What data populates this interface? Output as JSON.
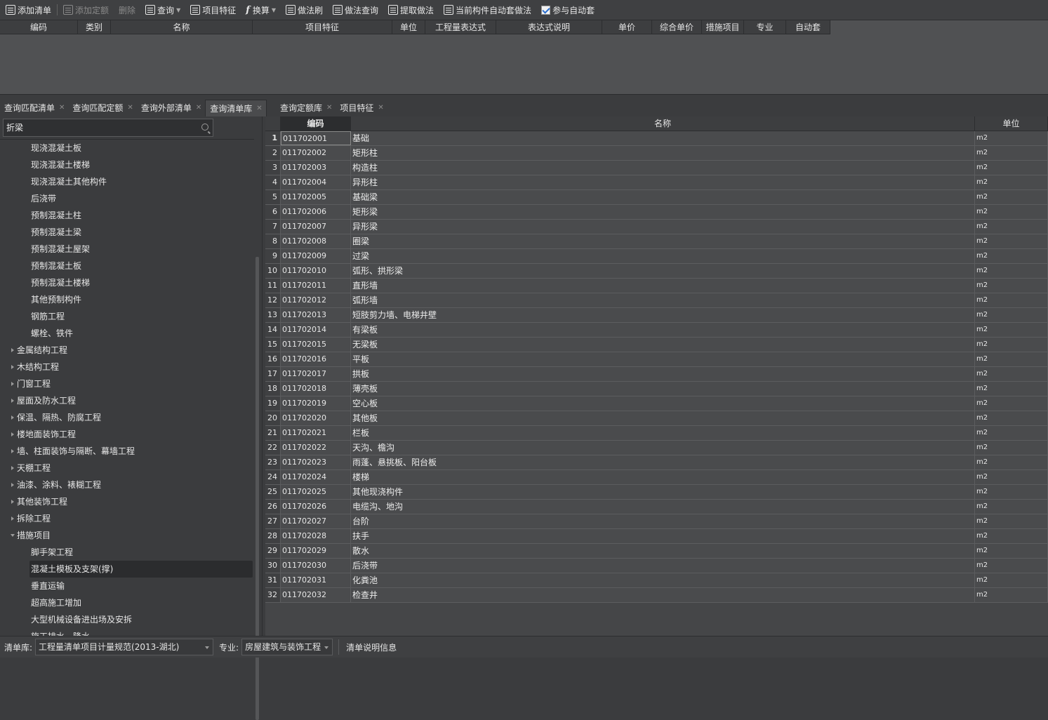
{
  "toolbar": {
    "add_list": "添加清单",
    "add_quota": "添加定额",
    "delete": "删除",
    "query": "查询",
    "item_feature": "项目特征",
    "convert": "换算",
    "method_brush": "做法刷",
    "method_query": "做法查询",
    "extract_method": "提取做法",
    "auto_apply_current": "当前构件自动套做法",
    "join_auto": "参与自动套"
  },
  "top_grid": {
    "columns": [
      "编码",
      "类别",
      "名称",
      "项目特征",
      "单位",
      "工程量表达式",
      "表达式说明",
      "单价",
      "综合单价",
      "措施项目",
      "专业",
      "自动套"
    ]
  },
  "left_tabs": [
    {
      "label": "查询匹配清单"
    },
    {
      "label": "查询匹配定额"
    },
    {
      "label": "查询外部清单"
    },
    {
      "label": "查询清单库"
    }
  ],
  "right_tabs": [
    {
      "label": "查询定额库"
    },
    {
      "label": "项目特征"
    }
  ],
  "search": {
    "value": "折梁"
  },
  "tree": [
    {
      "label": "现浇混凝土板",
      "level": 2
    },
    {
      "label": "现浇混凝土楼梯",
      "level": 2
    },
    {
      "label": "现浇混凝土其他构件",
      "level": 2
    },
    {
      "label": "后浇带",
      "level": 2
    },
    {
      "label": "预制混凝土柱",
      "level": 2
    },
    {
      "label": "预制混凝土梁",
      "level": 2
    },
    {
      "label": "预制混凝土屋架",
      "level": 2
    },
    {
      "label": "预制混凝土板",
      "level": 2
    },
    {
      "label": "预制混凝土楼梯",
      "level": 2
    },
    {
      "label": "其他预制构件",
      "level": 2
    },
    {
      "label": "钢筋工程",
      "level": 2
    },
    {
      "label": "螺栓、铁件",
      "level": 2
    },
    {
      "label": "金属结构工程",
      "level": 1,
      "expanded": false
    },
    {
      "label": "木结构工程",
      "level": 1,
      "expanded": false
    },
    {
      "label": "门窗工程",
      "level": 1,
      "expanded": false
    },
    {
      "label": "屋面及防水工程",
      "level": 1,
      "expanded": false
    },
    {
      "label": "保温、隔热、防腐工程",
      "level": 1,
      "expanded": false
    },
    {
      "label": "楼地面装饰工程",
      "level": 1,
      "expanded": false
    },
    {
      "label": "墙、柱面装饰与隔断、幕墙工程",
      "level": 1,
      "expanded": false
    },
    {
      "label": "天棚工程",
      "level": 1,
      "expanded": false
    },
    {
      "label": "油漆、涂料、裱糊工程",
      "level": 1,
      "expanded": false
    },
    {
      "label": "其他装饰工程",
      "level": 1,
      "expanded": false
    },
    {
      "label": "拆除工程",
      "level": 1,
      "expanded": false
    },
    {
      "label": "措施项目",
      "level": 1,
      "expanded": true
    },
    {
      "label": "脚手架工程",
      "level": 2
    },
    {
      "label": "混凝土模板及支架(撑)",
      "level": 2,
      "selected": true
    },
    {
      "label": "垂直运输",
      "level": 2
    },
    {
      "label": "超高施工增加",
      "level": 2
    },
    {
      "label": "大型机械设备进出场及安拆",
      "level": 2
    },
    {
      "label": "施工排水、降水",
      "level": 2
    }
  ],
  "grid": {
    "headers": {
      "code": "编码",
      "name": "名称",
      "unit": "单位"
    },
    "rows": [
      {
        "no": "1",
        "code": "011702001",
        "name": "基础",
        "unit": "m2"
      },
      {
        "no": "2",
        "code": "011702002",
        "name": "矩形柱",
        "unit": "m2"
      },
      {
        "no": "3",
        "code": "011702003",
        "name": "构造柱",
        "unit": "m2"
      },
      {
        "no": "4",
        "code": "011702004",
        "name": "异形柱",
        "unit": "m2"
      },
      {
        "no": "5",
        "code": "011702005",
        "name": "基础梁",
        "unit": "m2"
      },
      {
        "no": "6",
        "code": "011702006",
        "name": "矩形梁",
        "unit": "m2"
      },
      {
        "no": "7",
        "code": "011702007",
        "name": "异形梁",
        "unit": "m2"
      },
      {
        "no": "8",
        "code": "011702008",
        "name": "圈梁",
        "unit": "m2"
      },
      {
        "no": "9",
        "code": "011702009",
        "name": "过梁",
        "unit": "m2"
      },
      {
        "no": "10",
        "code": "011702010",
        "name": "弧形、拱形梁",
        "unit": "m2"
      },
      {
        "no": "11",
        "code": "011702011",
        "name": "直形墙",
        "unit": "m2"
      },
      {
        "no": "12",
        "code": "011702012",
        "name": "弧形墙",
        "unit": "m2"
      },
      {
        "no": "13",
        "code": "011702013",
        "name": "短肢剪力墙、电梯井壁",
        "unit": "m2"
      },
      {
        "no": "14",
        "code": "011702014",
        "name": "有梁板",
        "unit": "m2"
      },
      {
        "no": "15",
        "code": "011702015",
        "name": "无梁板",
        "unit": "m2"
      },
      {
        "no": "16",
        "code": "011702016",
        "name": "平板",
        "unit": "m2"
      },
      {
        "no": "17",
        "code": "011702017",
        "name": "拱板",
        "unit": "m2"
      },
      {
        "no": "18",
        "code": "011702018",
        "name": "薄壳板",
        "unit": "m2"
      },
      {
        "no": "19",
        "code": "011702019",
        "name": "空心板",
        "unit": "m2"
      },
      {
        "no": "20",
        "code": "011702020",
        "name": "其他板",
        "unit": "m2"
      },
      {
        "no": "21",
        "code": "011702021",
        "name": "栏板",
        "unit": "m2"
      },
      {
        "no": "22",
        "code": "011702022",
        "name": "天沟、檐沟",
        "unit": "m2"
      },
      {
        "no": "23",
        "code": "011702023",
        "name": "雨蓬、悬挑板、阳台板",
        "unit": "m2"
      },
      {
        "no": "24",
        "code": "011702024",
        "name": "楼梯",
        "unit": "m2"
      },
      {
        "no": "25",
        "code": "011702025",
        "name": "其他现浇构件",
        "unit": "m2"
      },
      {
        "no": "26",
        "code": "011702026",
        "name": "电缆沟、地沟",
        "unit": "m2"
      },
      {
        "no": "27",
        "code": "011702027",
        "name": "台阶",
        "unit": "m2"
      },
      {
        "no": "28",
        "code": "011702028",
        "name": "扶手",
        "unit": "m2"
      },
      {
        "no": "29",
        "code": "011702029",
        "name": "散水",
        "unit": "m2"
      },
      {
        "no": "30",
        "code": "011702030",
        "name": "后浇带",
        "unit": "m2"
      },
      {
        "no": "31",
        "code": "011702031",
        "name": "化粪池",
        "unit": "m2"
      },
      {
        "no": "32",
        "code": "011702032",
        "name": "检查井",
        "unit": "m2"
      }
    ]
  },
  "status": {
    "library_label": "清单库:",
    "library_value": "工程量清单项目计量规范(2013-湖北)",
    "major_label": "专业:",
    "major_value": "房屋建筑与装饰工程",
    "info": "清单说明信息"
  }
}
